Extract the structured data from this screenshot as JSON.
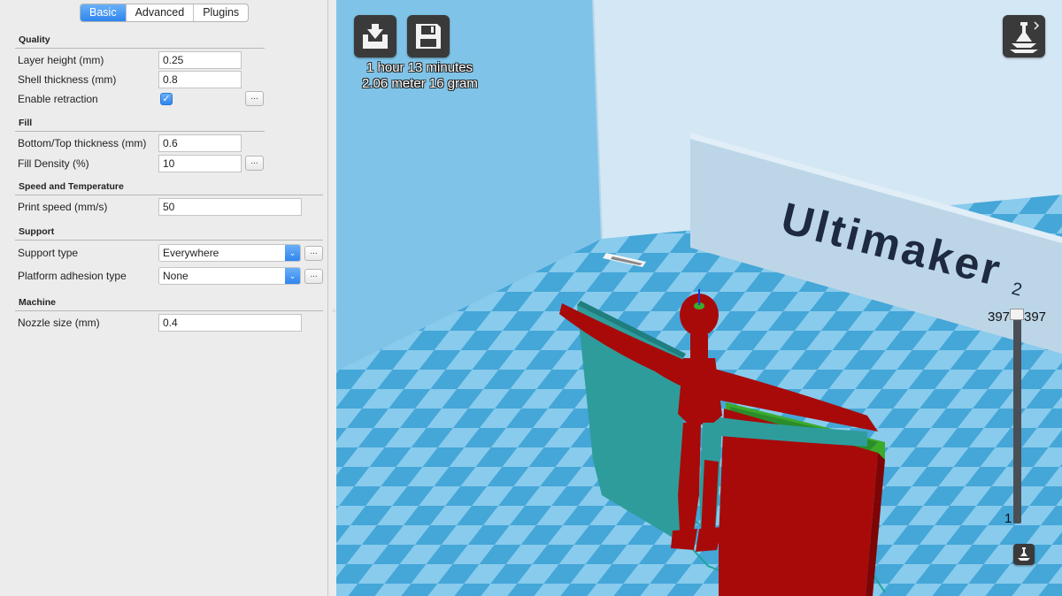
{
  "tabs": [
    {
      "label": "Basic",
      "active": true
    },
    {
      "label": "Advanced",
      "active": false
    },
    {
      "label": "Plugins",
      "active": false
    }
  ],
  "sections": {
    "quality": "Quality",
    "fill": "Fill",
    "speed": "Speed and Temperature",
    "support": "Support",
    "machine": "Machine"
  },
  "fields": {
    "layer_height": {
      "label": "Layer height (mm)",
      "value": "0.25"
    },
    "shell_thickness": {
      "label": "Shell thickness (mm)",
      "value": "0.8"
    },
    "enable_retraction": {
      "label": "Enable retraction",
      "checked": true
    },
    "bottom_top_thickness": {
      "label": "Bottom/Top thickness (mm)",
      "value": "0.6"
    },
    "fill_density": {
      "label": "Fill Density (%)",
      "value": "10"
    },
    "print_speed": {
      "label": "Print speed (mm/s)",
      "value": "50"
    },
    "support_type": {
      "label": "Support type",
      "value": "Everywhere"
    },
    "platform_adhesion": {
      "label": "Platform adhesion type",
      "value": "None"
    },
    "nozzle_size": {
      "label": "Nozzle size (mm)",
      "value": "0.4"
    }
  },
  "dots_label": "...",
  "check_glyph": "✓",
  "select_arrow": "⌄",
  "viewport": {
    "print_time": "1 hour 13 minutes",
    "print_material": "2.06 meter 16 gram",
    "brand_text": "Ultimaker",
    "brand_superscript": "2",
    "layer_max_left": "397",
    "layer_max_right": "397",
    "layer_min": "1",
    "layer_view_fraction": 1.0
  },
  "icons": [
    "load-model-icon",
    "save-gcode-icon",
    "view-mode-icon",
    "layer-view-icon"
  ],
  "colors": {
    "accent": "#3a8ff0",
    "model_red": "#a80a0a",
    "support_teal": "#2f9c9c",
    "fill_green": "#3cab2c",
    "bed_light": "#88cbec",
    "bed_dark": "#45a6d8",
    "wall": "#d8e9f5"
  }
}
